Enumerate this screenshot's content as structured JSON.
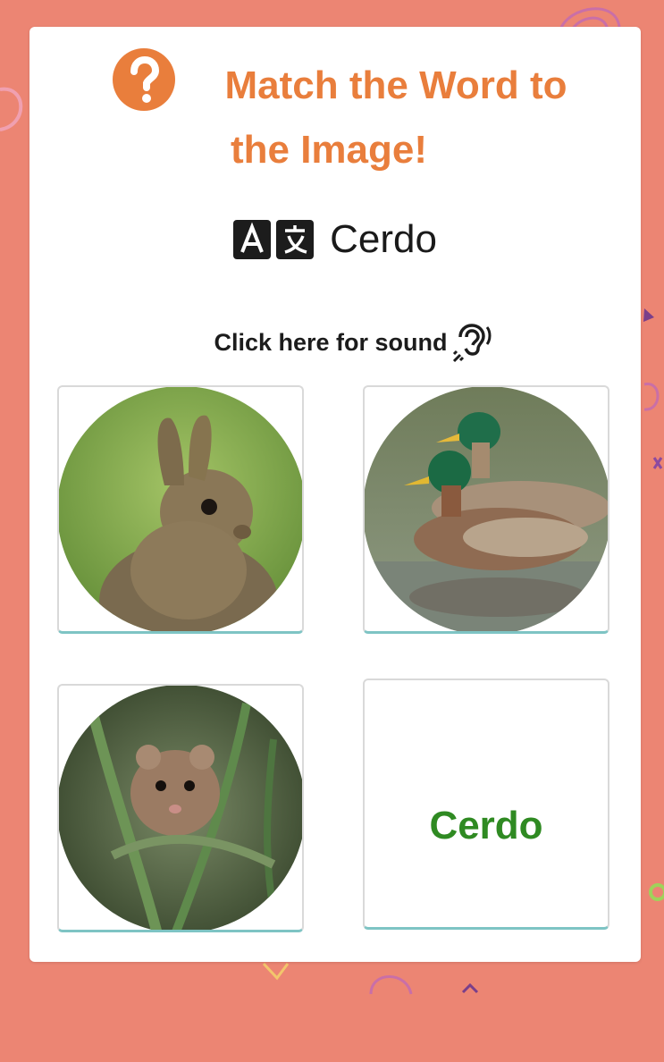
{
  "quiz": {
    "title_line1": "Match the Word to",
    "title_line2": "the Image!",
    "word": "Cerdo",
    "sound_label": "Click here for sound"
  },
  "tiles": [
    {
      "kind": "image",
      "subject": "rabbit"
    },
    {
      "kind": "image",
      "subject": "ducks"
    },
    {
      "kind": "image",
      "subject": "mouse"
    },
    {
      "kind": "word",
      "label": "Cerdo"
    }
  ],
  "icons": {
    "help": "question-circle-icon",
    "translate": "translate-icon",
    "sound": "hearing-icon"
  },
  "colors": {
    "background": "#ec8573",
    "title": "#e97e3c",
    "answer_word": "#2f8a22",
    "tile_accent": "#7ec4c4"
  }
}
